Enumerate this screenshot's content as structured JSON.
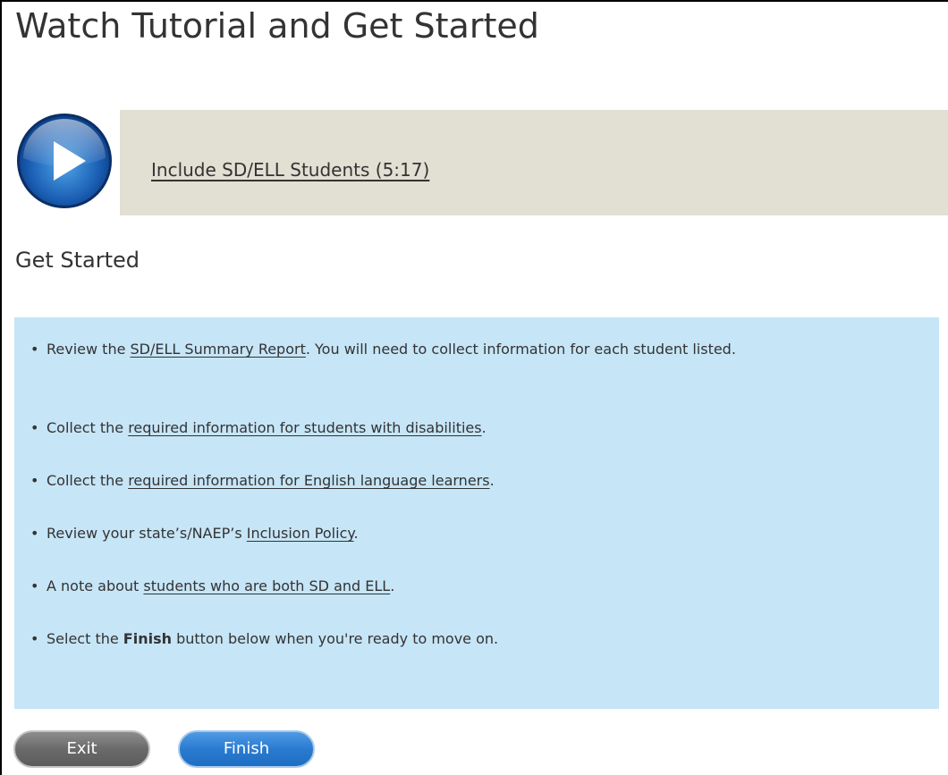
{
  "page": {
    "title": "Watch Tutorial and Get Started"
  },
  "tutorial": {
    "icon": "play-icon",
    "link_label": "Include SD/ELL Students (5:17)"
  },
  "get_started": {
    "heading": "Get Started",
    "steps": [
      {
        "before": "Review the ",
        "link": "SD/ELL Summary Report",
        "after": ". You will need to collect information for each student listed."
      },
      {
        "before": "Collect the ",
        "link": "required information for students with disabilities",
        "after": "."
      },
      {
        "before": "Collect the ",
        "link": "required information for English language learners",
        "after": "."
      },
      {
        "before": "Review your state’s/NAEP’s ",
        "link": "Inclusion Policy",
        "after": "."
      },
      {
        "before": "A note about ",
        "link": "students who are both SD and ELL",
        "after": "."
      },
      {
        "before": "Select the ",
        "bold": "Finish",
        "after": " button below when you're ready to move on."
      }
    ]
  },
  "buttons": {
    "exit_label": "Exit",
    "finish_label": "Finish"
  },
  "colors": {
    "tutorial_panel_bg": "#e2dfd3",
    "steps_panel_bg": "#c6e5f7",
    "exit_button": "#6a6a6a",
    "finish_button": "#2a7bd0"
  }
}
